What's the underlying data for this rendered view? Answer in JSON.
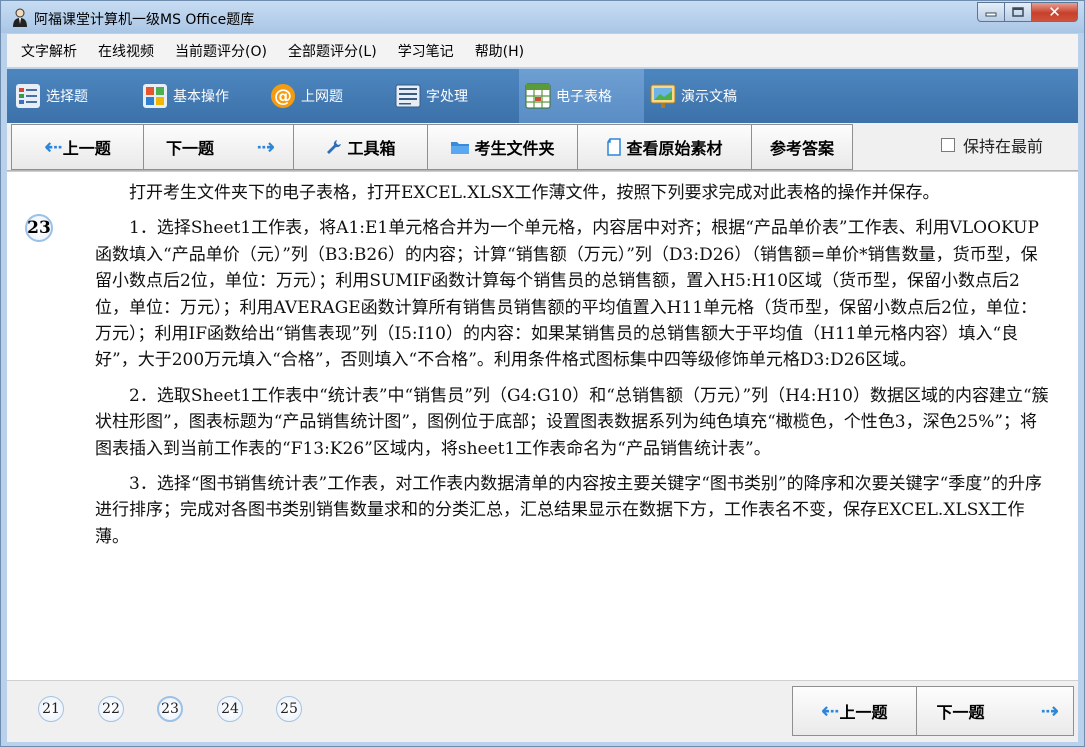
{
  "window": {
    "title": "阿福课堂计算机一级MS Office题库",
    "icons": {
      "app": "avatar-icon",
      "minimize": "minimize-icon",
      "maximize": "maximize-icon",
      "close": "close-icon"
    }
  },
  "menu": [
    "文字解析",
    "在线视频",
    "当前题评分(O)",
    "全部题评分(L)",
    "学习笔记",
    "帮助(H)"
  ],
  "tabs": [
    {
      "label": "选择题",
      "icon": "list-icon"
    },
    {
      "label": "基本操作",
      "icon": "windows-icon"
    },
    {
      "label": "上网题",
      "icon": "at-icon"
    },
    {
      "label": "字处理",
      "icon": "document-icon"
    },
    {
      "label": "电子表格",
      "icon": "spreadsheet-icon",
      "active": true
    },
    {
      "label": "演示文稿",
      "icon": "presentation-icon"
    }
  ],
  "toolbar": {
    "prev": "上一题",
    "next": "下一题",
    "toolbox": "工具箱",
    "student_folder": "考生文件夹",
    "view_source": "查看原始素材",
    "answer": "参考答案",
    "keep_front": "保持在最前",
    "keep_front_checked": false
  },
  "question": {
    "number": "23",
    "paragraphs": [
      "打开考生文件夹下的电子表格，打开EXCEL.XLSX工作薄文件，按照下列要求完成对此表格的操作并保存。",
      "1．选择Sheet1工作表，将A1:E1单元格合并为一个单元格，内容居中对齐；根据“产品单价表”工作表、利用VLOOKUP函数填入“产品单价（元）”列（B3:B26）的内容；计算“销售额（万元）”列（D3:D26）（销售额=单价*销售数量，货币型，保留小数点后2位，单位：万元）；利用SUMIF函数计算每个销售员的总销售额，置入H5:H10区域（货币型，保留小数点后2位，单位：万元）；利用AVERAGE函数计算所有销售员销售额的平均值置入H11单元格（货币型，保留小数点后2位，单位：万元）；利用IF函数给出“销售表现”列（I5:I10）的内容：如果某销售员的总销售额大于平均值（H11单元格内容）填入“良好”，大于200万元填入“合格”，否则填入“不合格”。利用条件格式图标集中四等级修饰单元格D3:D26区域。",
      "2．选取Sheet1工作表中“统计表”中“销售员”列（G4:G10）和“总销售额（万元）”列（H4:H10）数据区域的内容建立“簇状柱形图”，图表标题为“产品销售统计图”，图例位于底部；设置图表数据系列为纯色填充“橄榄色，个性色3，深色25%”；将图表插入到当前工作表的“F13:K26”区域内，将sheet1工作表命名为“产品销售统计表”。",
      "3．选择“图书销售统计表”工作表，对工作表内数据清单的内容按主要关键字“图书类别”的降序和次要关键字“季度”的升序进行排序；完成对各图书类别销售数量求和的分类汇总，汇总结果显示在数据下方，工作表名不变，保存EXCEL.XLSX工作薄。"
    ]
  },
  "bottom": {
    "question_numbers": [
      "21",
      "22",
      "23",
      "24",
      "25"
    ],
    "current": "23",
    "prev": "上一题",
    "next": "下一题"
  },
  "colors": {
    "tabbar": "#3f74ac",
    "accent_arrow": "#2e86d8",
    "window_bg": "#b9d1ea"
  }
}
